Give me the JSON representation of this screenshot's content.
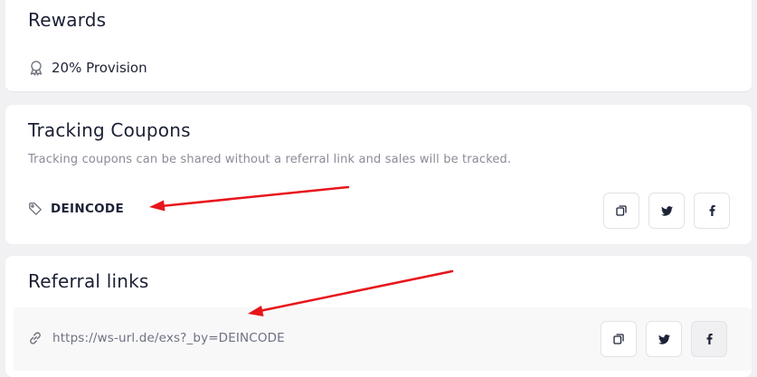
{
  "rewards": {
    "title": "Rewards",
    "provision_icon": "award-ribbon-icon",
    "provision_text": "20% Provision"
  },
  "coupons": {
    "title": "Tracking Coupons",
    "subtitle": "Tracking coupons can be shared without a referral link and sales will be tracked.",
    "code_icon": "tag-icon",
    "code": "DEINCODE",
    "buttons": {
      "copy": "copy-icon",
      "twitter": "twitter-icon",
      "facebook": "facebook-icon"
    }
  },
  "referral": {
    "title": "Referral links",
    "link_icon": "link-icon",
    "url": "https://ws-url.de/exs?_by=DEINCODE",
    "buttons": {
      "copy": "copy-icon",
      "twitter": "twitter-icon",
      "facebook": "facebook-icon"
    }
  },
  "colors": {
    "page_background": "#f1f1f3",
    "card_background": "#ffffff",
    "text_primary": "#1d2236",
    "text_muted": "#8a8c96",
    "annotation_arrow": "#e8141b"
  }
}
